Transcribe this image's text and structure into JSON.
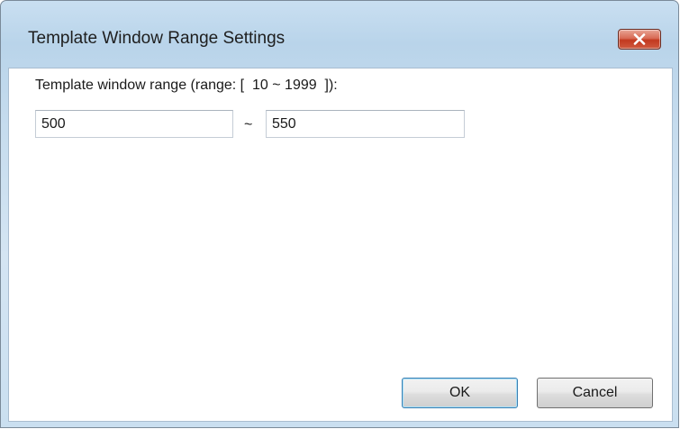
{
  "window": {
    "title": "Template Window Range Settings"
  },
  "form": {
    "range_label": "Template window range (range: [  10 ~ 1999  ]):",
    "from_value": "500",
    "separator": "~",
    "to_value": "550"
  },
  "buttons": {
    "ok_label": "OK",
    "cancel_label": "Cancel"
  },
  "icons": {
    "close": "close-icon"
  },
  "colors": {
    "close_button": "#c7402a",
    "ok_border": "#3c7fb1"
  }
}
